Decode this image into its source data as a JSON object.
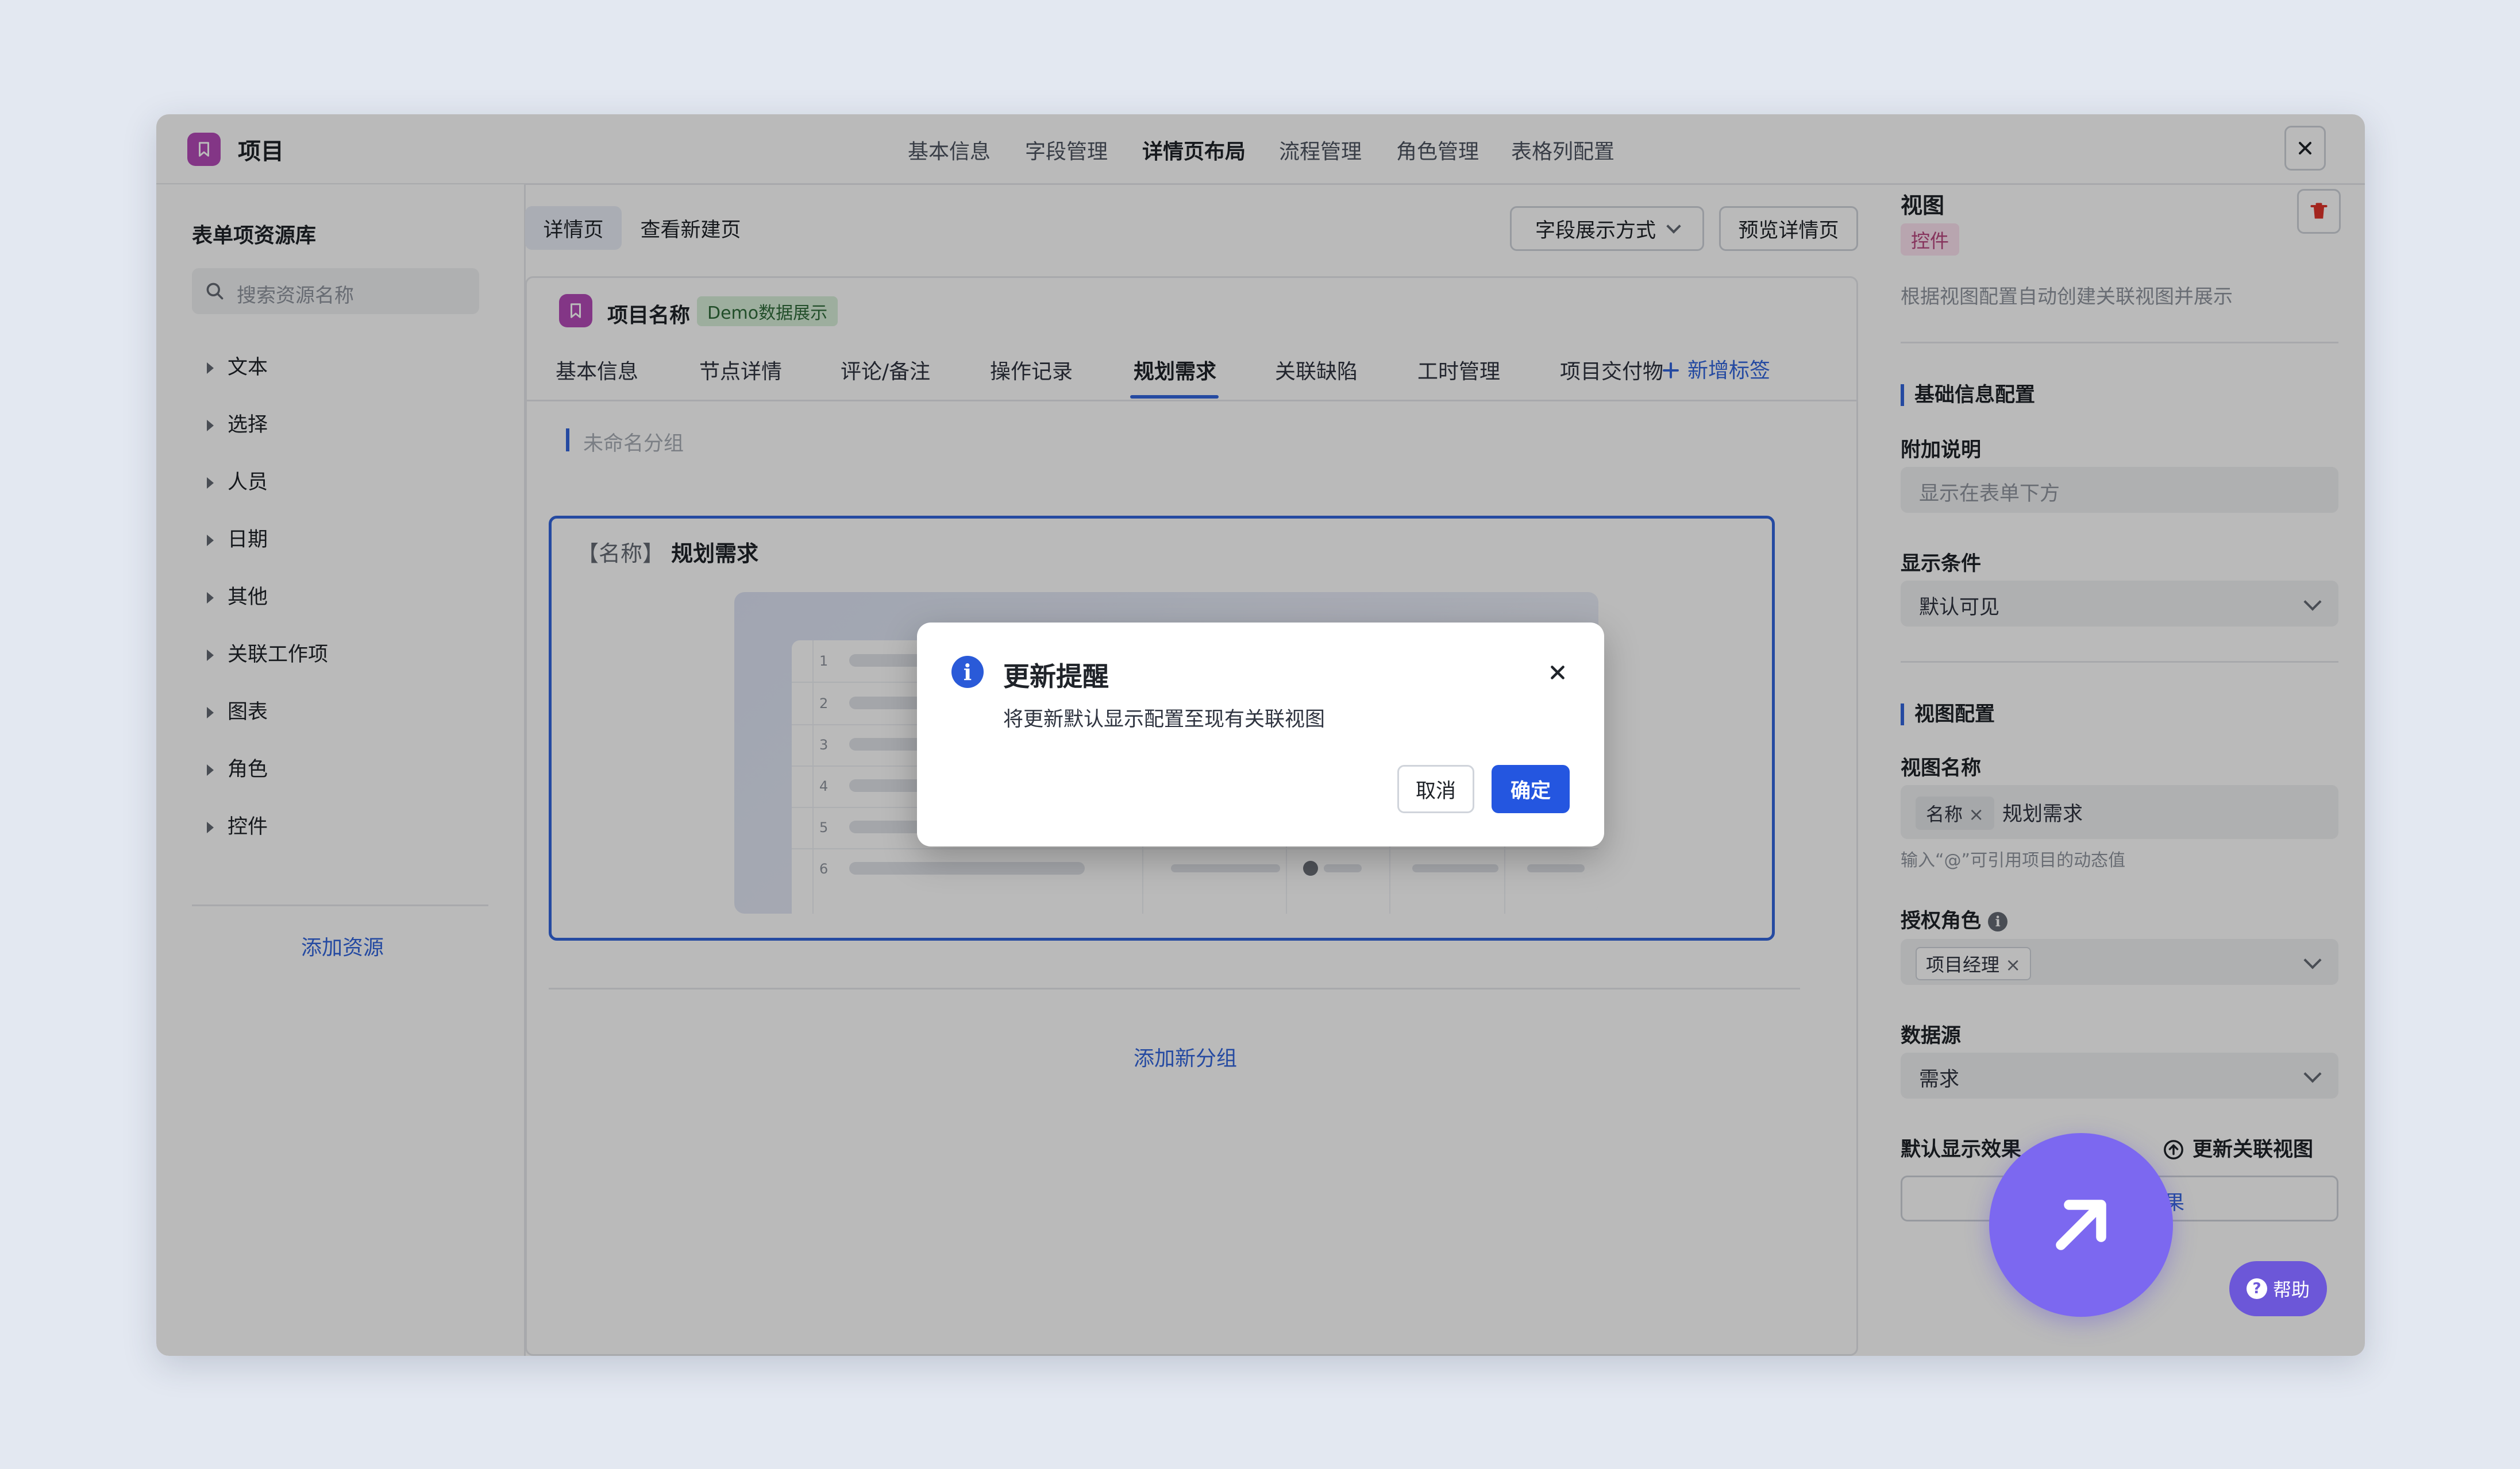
{
  "header": {
    "app_title": "项目",
    "tabs": [
      {
        "label": "基本信息"
      },
      {
        "label": "字段管理"
      },
      {
        "label": "详情页布局",
        "active": true
      },
      {
        "label": "流程管理"
      },
      {
        "label": "角色管理"
      },
      {
        "label": "表格列配置"
      }
    ]
  },
  "left_panel": {
    "title": "表单项资源库",
    "search_placeholder": "搜索资源名称",
    "categories": [
      "文本",
      "选择",
      "人员",
      "日期",
      "其他",
      "关联工作项",
      "图表",
      "角色",
      "控件"
    ],
    "add_resource": "添加资源"
  },
  "toolbar": {
    "seg_detail": "详情页",
    "seg_new": "查看新建页",
    "field_display": "字段展示方式",
    "preview": "预览详情页"
  },
  "card": {
    "project_name": "项目名称",
    "demo_badge": "Demo数据展示",
    "tabs": [
      "基本信息",
      "节点详情",
      "评论/备注",
      "操作记录",
      "规划需求",
      "关联缺陷",
      "工时管理",
      "项目交付物"
    ],
    "active_tab": "规划需求",
    "add_tab": "新增标签",
    "group_label": "未命名分组",
    "component_prefix": "【名称】",
    "component_name": "规划需求",
    "row_numbers": [
      "1",
      "2",
      "3",
      "4",
      "5",
      "6"
    ],
    "add_group": "添加新分组"
  },
  "right_panel": {
    "title": "视图",
    "badge": "控件",
    "description": "根据视图配置自动创建关联视图并展示",
    "basic_section": "基础信息配置",
    "note_label": "附加说明",
    "note_placeholder": "显示在表单下方",
    "condition_label": "显示条件",
    "condition_value": "默认可见",
    "view_section": "视图配置",
    "view_name_label": "视图名称",
    "view_name_chip": "名称",
    "view_name_text": "规划需求",
    "view_name_hint": "输入“@”可引用项目的动态值",
    "role_label": "授权角色",
    "role_chip": "项目经理",
    "source_label": "数据源",
    "source_value": "需求",
    "default_effect_label": "默认显示效果",
    "update_view": "更新关联视图",
    "effect_button_partial": "果"
  },
  "dialog": {
    "title": "更新提醒",
    "body": "将更新默认显示配置至现有关联视图",
    "cancel": "取消",
    "confirm": "确定"
  },
  "help": {
    "label": "帮助"
  },
  "colors": {
    "accent": "#3366dd",
    "logo": "#b44ab8",
    "fab": "#7c68f0",
    "demo_badge_bg": "#d7efd9"
  }
}
